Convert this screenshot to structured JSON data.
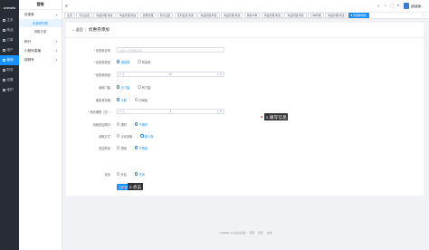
{
  "brand": "crmeb",
  "nav1": [
    {
      "label": "主页"
    },
    {
      "label": "商品"
    },
    {
      "label": "订单"
    },
    {
      "label": "用户"
    },
    {
      "label": "营销"
    },
    {
      "label": "财务"
    },
    {
      "label": "设置"
    },
    {
      "label": "维护"
    }
  ],
  "nav2": {
    "title": "营销",
    "group_coupon": "优惠券",
    "coupon_list": "优惠券列表",
    "coupon_record": "领取记录",
    "group_points": "积分",
    "group_live": "小程序直播",
    "group_video": "视频号"
  },
  "topbar": {
    "user": "[超级管..."
  },
  "tabs": [
    {
      "label": "主页"
    },
    {
      "label": "平台设置"
    },
    {
      "label": "商品管理 修改"
    },
    {
      "label": "商品管理 修改"
    },
    {
      "label": "优惠管理"
    },
    {
      "label": "积分设置"
    },
    {
      "label": "签到设置 修改"
    },
    {
      "label": "商品管理 修改"
    },
    {
      "label": "商品管理 修改"
    },
    {
      "label": "微信卡券"
    },
    {
      "label": "商品管理 修改"
    },
    {
      "label": "商品管理 修改"
    },
    {
      "label": "订单管理"
    },
    {
      "label": "商品管理 修改"
    },
    {
      "label": "优惠券添加",
      "active": true
    }
  ],
  "page": {
    "back": "返回",
    "title": "优惠券添加"
  },
  "form": {
    "name_label": "* 优惠券名称：",
    "name_placeholder": "请输入优惠券名称",
    "type_label": "* 优惠劵类型：",
    "type_opt1": "通用券",
    "type_opt2": "商品券",
    "amount_label": "* 优惠券面值：",
    "amount_value": "0",
    "threshold_label": "使用门槛：",
    "threshold_opt1": "无门槛",
    "threshold_opt2": "有门槛",
    "validity_label": "使用有效期：",
    "validity_opt1": "天数",
    "validity_opt2": "时间段",
    "days_label": "* 有效期限（天）：",
    "days_value": "1",
    "limit_label": "领取是否限时：",
    "limit_opt1": "限时",
    "limit_opt2": "不限时",
    "method_label": "领取方式：",
    "method_opt1": "手动领取",
    "method_opt2": "新人券",
    "qty_label": "是否限量：",
    "qty_opt1": "限量",
    "qty_opt2": "不限量",
    "status_label": "状态：",
    "status_opt1": "开启",
    "status_opt2": "关闭",
    "submit": "立即创建"
  },
  "annotations": {
    "fill": "1.填写信息",
    "click": "2.点击"
  },
  "footer": {
    "copyright": "CRMEB Java后台系统",
    "links": [
      "官网",
      "社区",
      "文档"
    ]
  }
}
